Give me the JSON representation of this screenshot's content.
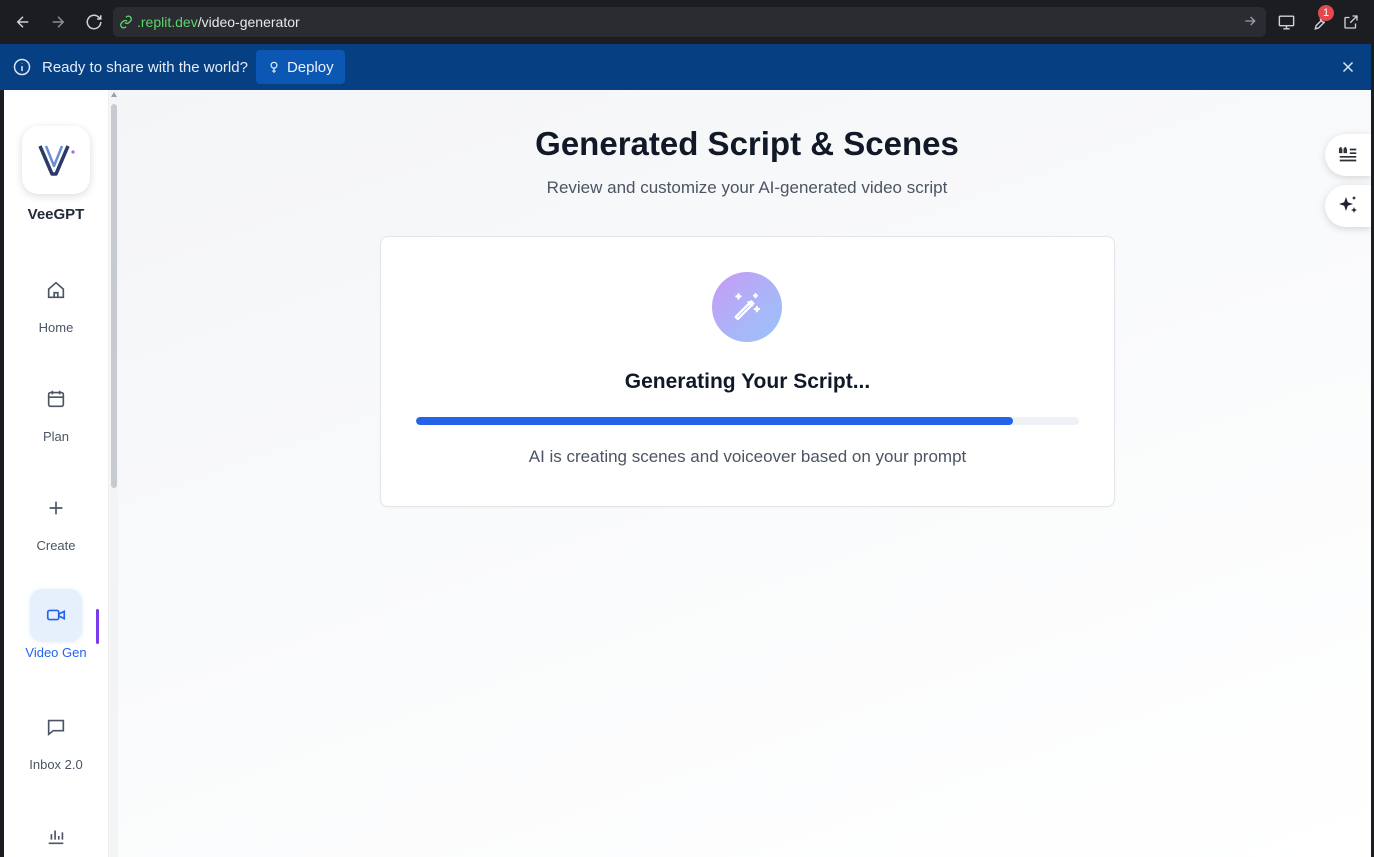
{
  "browser": {
    "url_host": ".replit.dev",
    "url_path": "/video-generator",
    "notification_count": "1"
  },
  "banner": {
    "message": "Ready to share with the world?",
    "deploy_label": "Deploy"
  },
  "sidebar": {
    "brand": "VeeGPT",
    "items": [
      {
        "label": "Home",
        "icon": "home-icon"
      },
      {
        "label": "Plan",
        "icon": "calendar-icon"
      },
      {
        "label": "Create",
        "icon": "plus-icon"
      },
      {
        "label": "Video Gen",
        "icon": "video-icon",
        "active": true
      },
      {
        "label": "Inbox 2.0",
        "icon": "message-icon"
      },
      {
        "label": "",
        "icon": "bar-chart-icon"
      }
    ]
  },
  "main": {
    "title": "Generated Script & Scenes",
    "subtitle": "Review and customize your AI-generated video script",
    "generating": {
      "title": "Generating Your Script...",
      "description": "AI is creating scenes and voiceover based on your prompt",
      "progress_percent": 90
    }
  },
  "colors": {
    "accent": "#2563eb",
    "banner": "#063f82",
    "active_indicator": "#7c3aed"
  }
}
